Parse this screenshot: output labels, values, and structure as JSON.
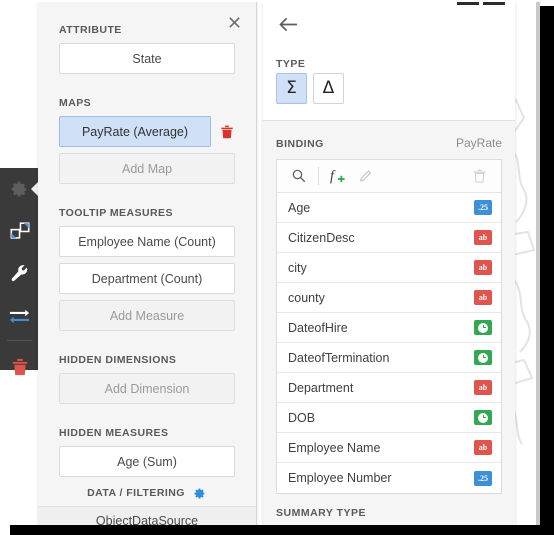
{
  "left_panel": {
    "close_icon": "close-icon",
    "sections": [
      {
        "title": "ATTRIBUTE",
        "items": [
          {
            "label": "State",
            "state": "normal",
            "deletable": false
          }
        ]
      },
      {
        "title": "MAPS",
        "items": [
          {
            "label": "PayRate (Average)",
            "state": "selected",
            "deletable": true
          },
          {
            "label": "Add Map",
            "state": "placeholder",
            "deletable": false
          }
        ]
      },
      {
        "title": "TOOLTIP MEASURES",
        "items": [
          {
            "label": "Employee Name (Count)",
            "state": "normal",
            "deletable": false
          },
          {
            "label": "Department (Count)",
            "state": "normal",
            "deletable": false
          },
          {
            "label": "Add Measure",
            "state": "placeholder",
            "deletable": false
          }
        ]
      },
      {
        "title": "HIDDEN DIMENSIONS",
        "items": [
          {
            "label": "Add Dimension",
            "state": "placeholder",
            "deletable": false
          }
        ]
      },
      {
        "title": "HIDDEN MEASURES",
        "items": [
          {
            "label": "Age (Sum)",
            "state": "normal",
            "deletable": false
          },
          {
            "label": "",
            "state": "normal",
            "deletable": false
          }
        ]
      }
    ],
    "data_filtering_label": "DATA / FILTERING",
    "data_filtering_icon": "gear-icon",
    "datasource_label": "ObjectDataSource"
  },
  "rail": {
    "items": [
      {
        "icon": "gear-icon",
        "active": true
      },
      {
        "icon": "layers-icon",
        "active": false
      },
      {
        "icon": "wrench-icon",
        "active": false
      },
      {
        "icon": "swap-arrows-icon",
        "active": false
      },
      {
        "icon": "trash-icon",
        "active": false
      }
    ]
  },
  "right_panel": {
    "back_icon": "back-arrow-icon",
    "type_label": "TYPE",
    "type_buttons": [
      {
        "glyph": "Σ",
        "name": "summary-type-button",
        "active": true
      },
      {
        "glyph": "Δ",
        "name": "delta-type-button",
        "active": false
      }
    ],
    "binding_label": "BINDING",
    "binding_value": "PayRate",
    "toolbar": [
      {
        "icon": "search-icon",
        "enabled": true
      },
      {
        "icon": "add-formula-icon",
        "enabled": true
      },
      {
        "icon": "pencil-icon",
        "enabled": false
      },
      {
        "icon": "trash-icon",
        "enabled": false
      }
    ],
    "fields": [
      {
        "name": "Age",
        "type": "number"
      },
      {
        "name": "CitizenDesc",
        "type": "string"
      },
      {
        "name": "city",
        "type": "string"
      },
      {
        "name": "county",
        "type": "string"
      },
      {
        "name": "DateofHire",
        "type": "date"
      },
      {
        "name": "DateofTermination",
        "type": "date"
      },
      {
        "name": "Department",
        "type": "string"
      },
      {
        "name": "DOB",
        "type": "date"
      },
      {
        "name": "Employee Name",
        "type": "string"
      },
      {
        "name": "Employee Number",
        "type": "number"
      }
    ],
    "summary_type_label": "SUMMARY TYPE"
  },
  "colors": {
    "accent_blue": "#3e8fd6",
    "selection_blue": "#cfe0f7",
    "string_red": "#e0544e",
    "date_green": "#32a852",
    "rail_dark": "#3a3a3a",
    "delete_red": "#d9342b"
  },
  "badge_text": {
    "number": ".25",
    "string": "ab"
  }
}
